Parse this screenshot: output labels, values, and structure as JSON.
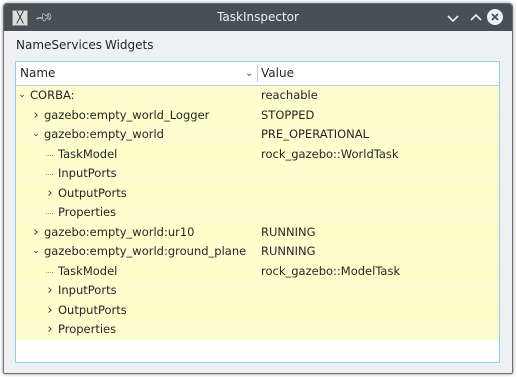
{
  "window": {
    "title": "TaskInspector"
  },
  "icons": {
    "app": "x-app-icon",
    "pin": "pin-icon",
    "minimize": "chevron-down-icon",
    "maximize": "chevron-up-icon",
    "close": "close-icon"
  },
  "menu": {
    "items": [
      "NameServices",
      "Widgets"
    ]
  },
  "tree": {
    "headers": {
      "name": "Name",
      "value": "Value"
    },
    "rows": [
      {
        "name": "CORBA:",
        "value": "reachable",
        "depth": 0,
        "arrow": "expanded"
      },
      {
        "name": "gazebo:empty_world_Logger",
        "value": "STOPPED",
        "depth": 1,
        "arrow": "collapsed"
      },
      {
        "name": "gazebo:empty_world",
        "value": "PRE_OPERATIONAL",
        "depth": 1,
        "arrow": "expanded"
      },
      {
        "name": "TaskModel",
        "value": "rock_gazebo::WorldTask",
        "depth": 2,
        "arrow": "none"
      },
      {
        "name": "InputPorts",
        "value": "",
        "depth": 2,
        "arrow": "none"
      },
      {
        "name": "OutputPorts",
        "value": "",
        "depth": 2,
        "arrow": "collapsed"
      },
      {
        "name": "Properties",
        "value": "",
        "depth": 2,
        "arrow": "none"
      },
      {
        "name": "gazebo:empty_world:ur10",
        "value": "RUNNING",
        "depth": 1,
        "arrow": "collapsed"
      },
      {
        "name": "gazebo:empty_world:ground_plane",
        "value": "RUNNING",
        "depth": 1,
        "arrow": "expanded"
      },
      {
        "name": "TaskModel",
        "value": "rock_gazebo::ModelTask",
        "depth": 2,
        "arrow": "none"
      },
      {
        "name": "InputPorts",
        "value": "",
        "depth": 2,
        "arrow": "collapsed"
      },
      {
        "name": "OutputPorts",
        "value": "",
        "depth": 2,
        "arrow": "collapsed"
      },
      {
        "name": "Properties",
        "value": "",
        "depth": 2,
        "arrow": "collapsed"
      }
    ]
  }
}
